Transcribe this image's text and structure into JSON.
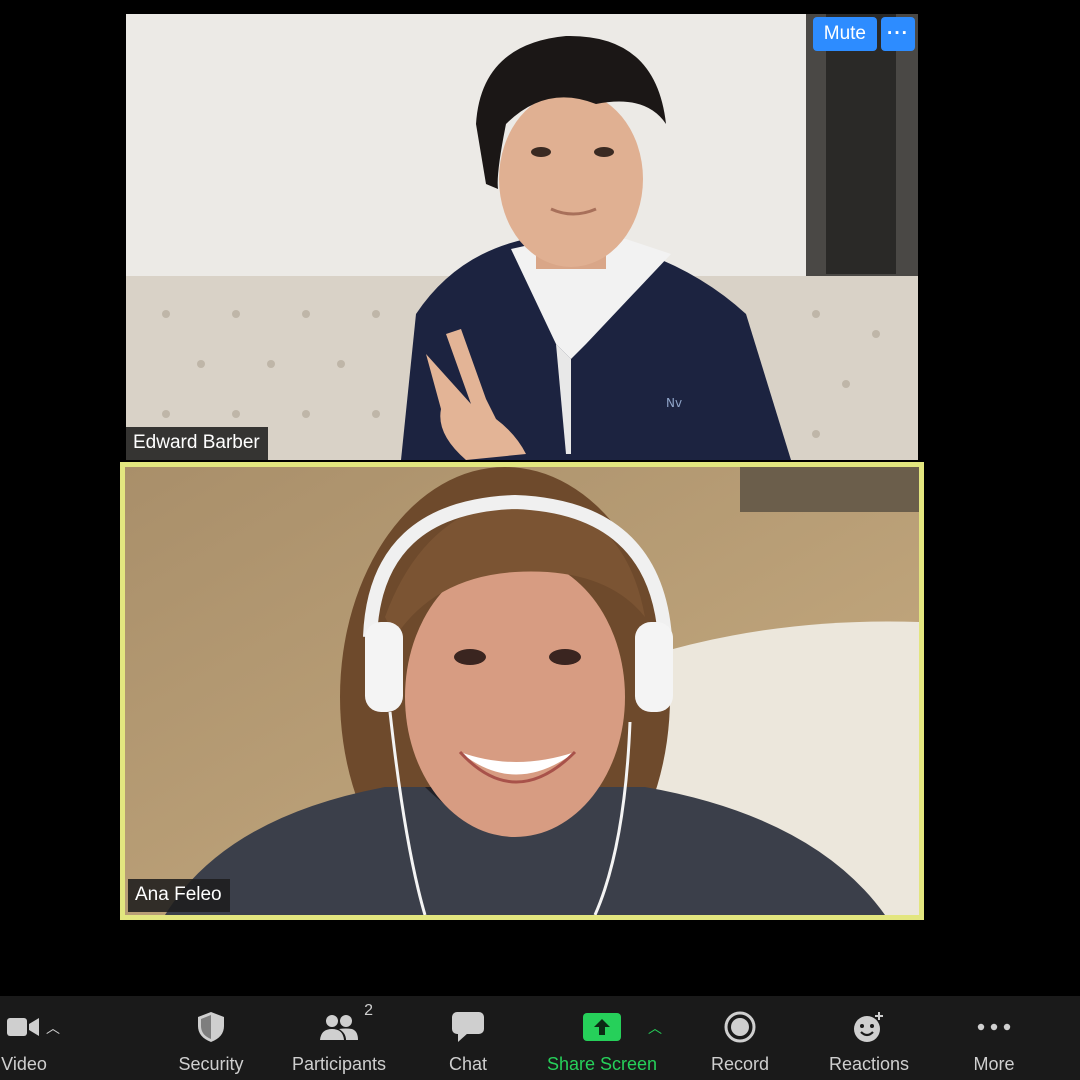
{
  "meeting": {
    "participants": [
      {
        "name": "Edward Barber",
        "status": "speaking-mute-controls"
      },
      {
        "name": "Ana Feleo",
        "status": "active-speaker"
      }
    ],
    "tile_controls": {
      "mute_label": "Mute",
      "more_label": "···"
    }
  },
  "toolbar": {
    "video_label": "Video",
    "security_label": "Security",
    "participants_label": "Participants",
    "participants_count": "2",
    "chat_label": "Chat",
    "share_label": "Share Screen",
    "record_label": "Record",
    "reactions_label": "Reactions",
    "more_label": "More"
  },
  "colors": {
    "accent": "#2d8cff",
    "share_green": "#26d05a",
    "active_border": "#e3e67f",
    "toolbar_bg": "#1a1a1a"
  }
}
